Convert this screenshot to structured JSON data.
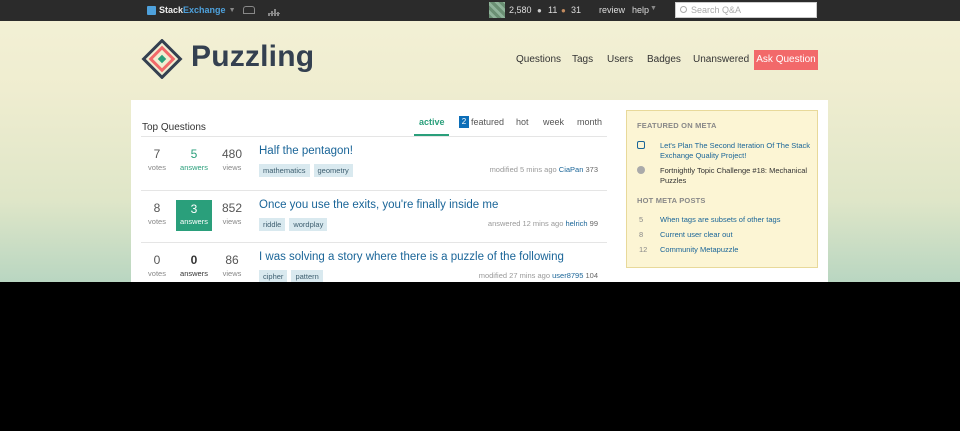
{
  "topbar": {
    "brand_a": "Stack",
    "brand_b": "Exchange",
    "reputation": "2,580",
    "silver_count": "11",
    "bronze_count": "31",
    "review": "review",
    "help": "help",
    "search_placeholder": "Search Q&A"
  },
  "site": {
    "name": "Puzzling",
    "nav": [
      "Questions",
      "Tags",
      "Users",
      "Badges",
      "Unanswered"
    ],
    "ask": "Ask Question",
    "accent": "#f2696a"
  },
  "main": {
    "title": "Top Questions",
    "tabs": [
      "active",
      "featured",
      "hot",
      "week",
      "month"
    ],
    "featured_count": "2",
    "questions": [
      {
        "votes": "7",
        "votes_label": "votes",
        "answers": "5",
        "answers_label": "answers",
        "views": "480",
        "views_label": "views",
        "title": "Half the pentagon!",
        "tags": [
          "mathematics",
          "geometry"
        ],
        "meta": "modified 5 mins ago",
        "user": "CiaPan",
        "rep": "373"
      },
      {
        "votes": "8",
        "votes_label": "votes",
        "answers": "3",
        "answers_label": "answers",
        "views": "852",
        "views_label": "views",
        "title": "Once you use the exits, you're finally inside me",
        "tags": [
          "riddle",
          "wordplay"
        ],
        "meta": "answered 12 mins ago",
        "user": "helrich",
        "rep": "99"
      },
      {
        "votes": "0",
        "votes_label": "votes",
        "answers": "0",
        "answers_label": "answers",
        "views": "86",
        "views_label": "views",
        "title": "I was solving a story where there is a puzzle of the following",
        "tags": [
          "cipher",
          "pattern"
        ],
        "meta": "modified 27 mins ago",
        "user": "user8795",
        "rep": "104"
      }
    ]
  },
  "sidebar": {
    "featured_head": "FEATURED ON META",
    "featured": [
      "Let's Plan The Second Iteration Of The Stack Exchange Quality Project!",
      "Fortnightly Topic Challenge #18: Mechanical Puzzles"
    ],
    "hot_head": "HOT META POSTS",
    "hot": [
      {
        "count": "5",
        "title": "When tags are subsets of other tags"
      },
      {
        "count": "8",
        "title": "Current user clear out"
      },
      {
        "count": "12",
        "title": "Community Metapuzzle"
      }
    ]
  }
}
